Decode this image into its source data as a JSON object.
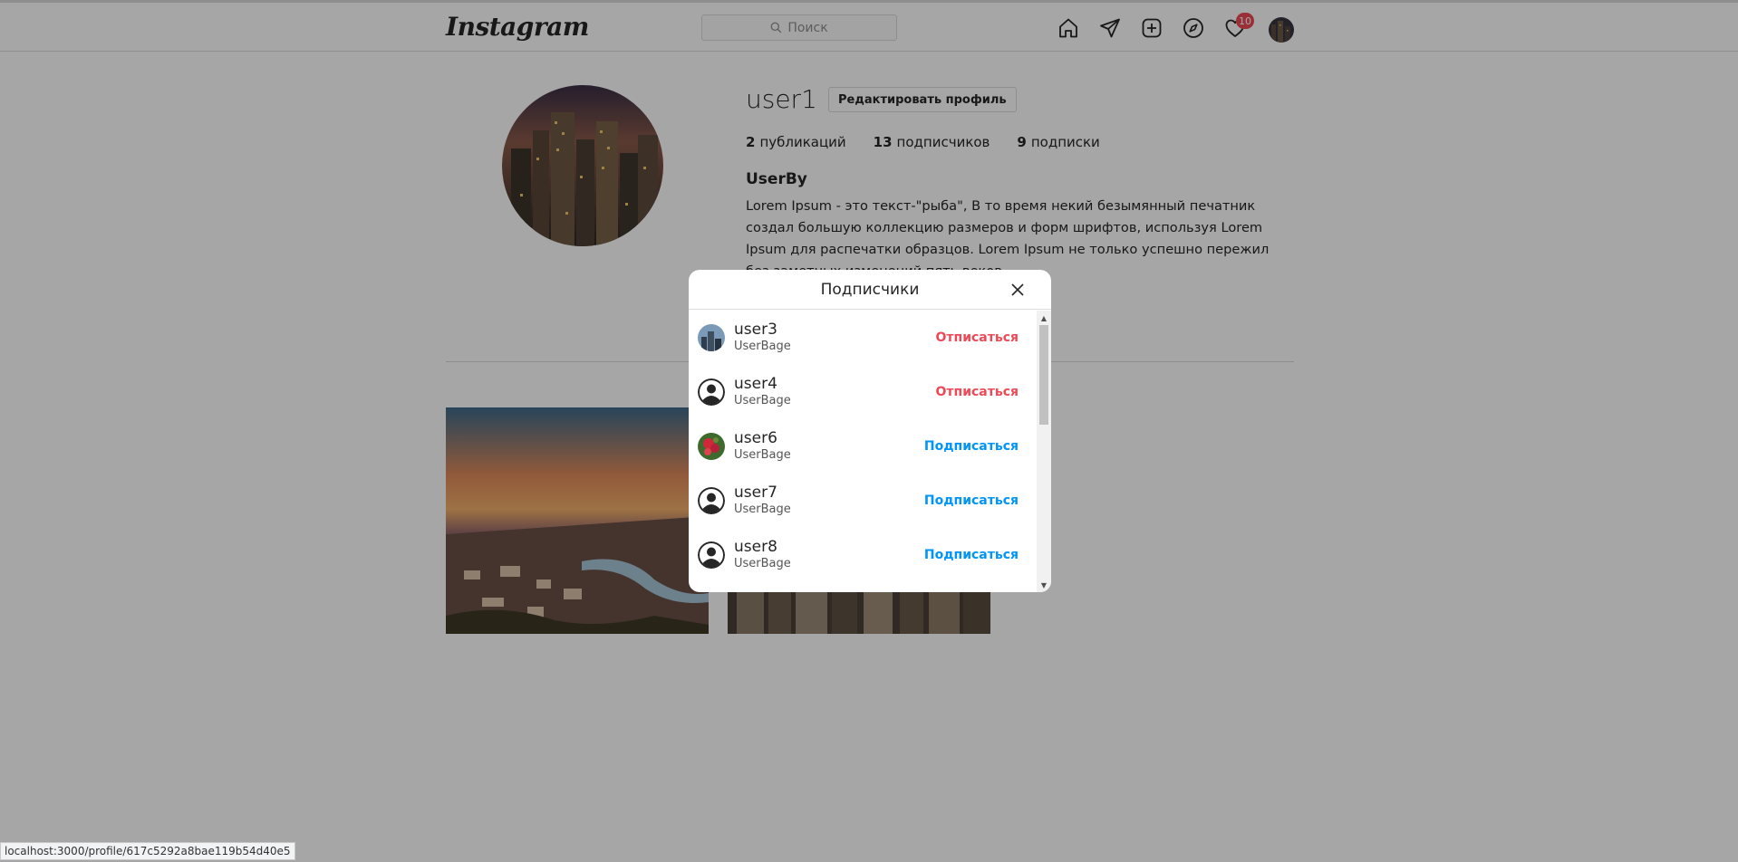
{
  "header": {
    "logo": "Instagram",
    "search_placeholder": "Поиск",
    "notifications_count": "10"
  },
  "profile": {
    "username": "user1",
    "edit_label": "Редактировать профиль",
    "stats": {
      "posts_count": "2",
      "posts_label": "публикаций",
      "followers_count": "13",
      "followers_label": "подписчиков",
      "following_count": "9",
      "following_label": "подписки"
    },
    "full_name": "UserBy",
    "bio": "Lorem Ipsum - это текст-\"рыба\", В то время некий безымянный печатник создал большую коллекцию размеров и форм шрифтов, используя Lorem Ipsum для распечатки образцов. Lorem Ipsum не только успешно пережил без заметных изменений пять веков"
  },
  "modal": {
    "title": "Подписчики",
    "followers": [
      {
        "username": "user3",
        "subtitle": "UserBage",
        "action": "Отписаться",
        "avatar": "city-photo"
      },
      {
        "username": "user4",
        "subtitle": "UserBage",
        "action": "Отписаться",
        "avatar": "default-user-icon"
      },
      {
        "username": "user6",
        "subtitle": "UserBage",
        "action": "Подписаться",
        "avatar": "flower-photo"
      },
      {
        "username": "user7",
        "subtitle": "UserBage",
        "action": "Подписаться",
        "avatar": "default-user-icon"
      },
      {
        "username": "user8",
        "subtitle": "UserBage",
        "action": "Подписаться",
        "avatar": "default-user-icon"
      }
    ]
  },
  "status_bar": {
    "url": "localhost:3000/profile/617c5292a8bae119b54d40e5"
  },
  "colors": {
    "unfollow": "#ed4956",
    "follow": "#0095f6",
    "badge": "#ed4956"
  }
}
